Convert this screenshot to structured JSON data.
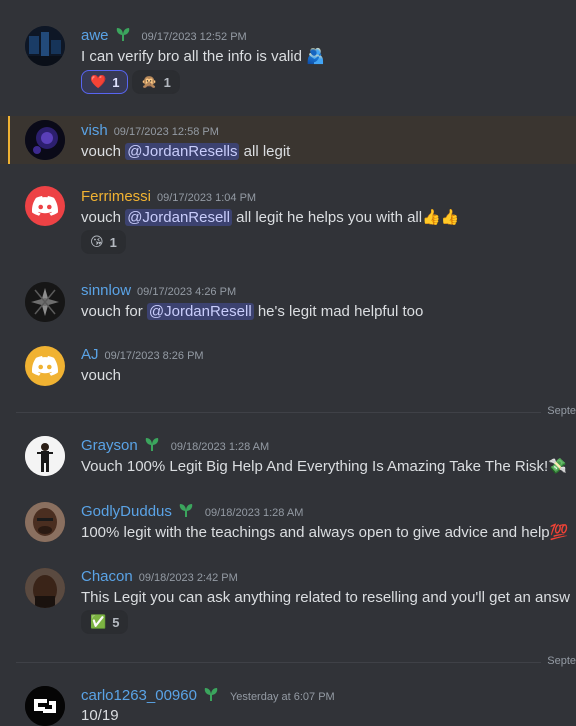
{
  "colors": {
    "background": "#313338",
    "text": "#dbdee1",
    "muted": "#949ba4",
    "mention_bg": "#3c4270",
    "discord_red": "#ed4245",
    "discord_orange": "#f0b232"
  },
  "messages": [
    {
      "author": "awe",
      "author_color": "#5aa3e6",
      "has_sprout": true,
      "time": "09/17/2023 12:52 PM",
      "text": "I can verify bro all the info is valid",
      "trailing_emoji": "🫂",
      "reactions": [
        {
          "emoji": "❤️",
          "count": "1",
          "active": true
        },
        {
          "emoji": "🙊",
          "count": "1",
          "active": false
        }
      ]
    },
    {
      "author": "vish",
      "author_color": "#5aa3e6",
      "time": "09/17/2023 12:58 PM",
      "pre": "vouch ",
      "mention": "@JordanResells",
      "post": " all legit"
    },
    {
      "author": "Ferrimessi",
      "author_color": "#f0b232",
      "time": "09/17/2023 1:04 PM",
      "pre": "vouch ",
      "mention": "@JordanResell",
      "post": " all legit he helps you with all",
      "trailing_emoji": "👍👍",
      "reactions": [
        {
          "emoji": "😘",
          "count": "1",
          "active": false
        }
      ]
    },
    {
      "author": "sinnlow",
      "author_color": "#5aa3e6",
      "time": "09/17/2023 4:26 PM",
      "pre": "vouch for ",
      "mention": "@JordanResell",
      "post": " he's legit mad helpful too"
    },
    {
      "author": "AJ",
      "author_color": "#5aa3e6",
      "time": "09/17/2023 8:26 PM",
      "text": "vouch"
    },
    {
      "author": "Grayson",
      "author_color": "#5aa3e6",
      "has_sprout": true,
      "time": "09/18/2023 1:28 AM",
      "text": "Vouch 100% Legit Big Help And Everything Is Amazing Take The Risk!",
      "trailing_emoji": "💸"
    },
    {
      "author": "GodlyDuddus",
      "author_color": "#5aa3e6",
      "has_sprout": true,
      "time": "09/18/2023 1:28 AM",
      "text": "100% legit with the teachings and always open to give advice and help",
      "trailing_emoji": "💯"
    },
    {
      "author": "Chacon",
      "author_color": "#5aa3e6",
      "time": "09/18/2023 2:42 PM",
      "text": "This Legit you can ask anything related to reselling and you'll  get an answ",
      "reactions": [
        {
          "emoji": "✅",
          "count": "5",
          "active": false
        }
      ]
    },
    {
      "author": "carlo1263_00960",
      "author_color": "#5aa3e6",
      "has_sprout": true,
      "time": "Yesterday at 6:07 PM",
      "text": "10/19"
    }
  ],
  "dividers": [
    {
      "label": "Septe"
    },
    {
      "label": "Septe"
    }
  ]
}
